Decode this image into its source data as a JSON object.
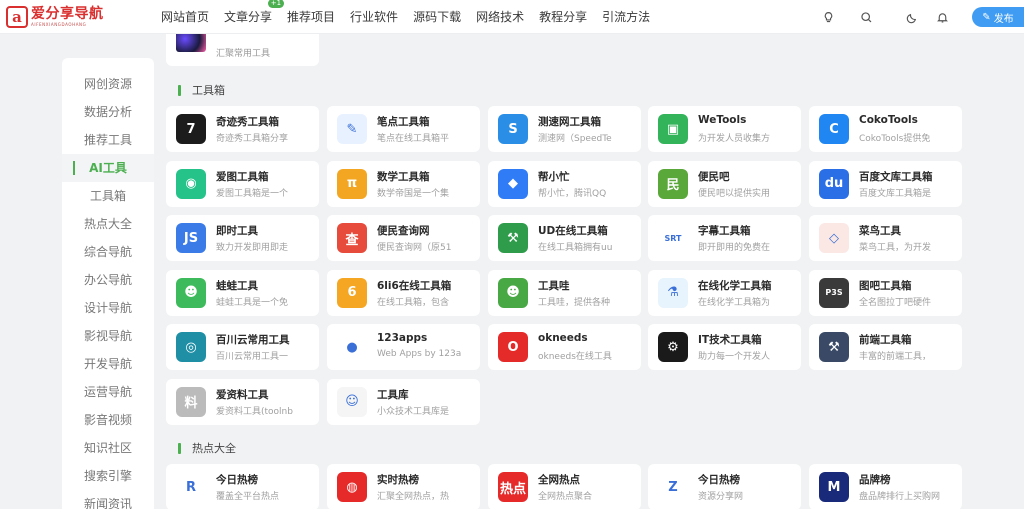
{
  "site": {
    "logo_main": "爱分享导航",
    "logo_sub": "AIFENXIANGDAOHANG",
    "logo_letter": "a"
  },
  "nav": [
    {
      "label": "网站首页"
    },
    {
      "label": "文章分享",
      "badge": "+1"
    },
    {
      "label": "推荐项目"
    },
    {
      "label": "行业软件"
    },
    {
      "label": "源码下载"
    },
    {
      "label": "网络技术"
    },
    {
      "label": "教程分享"
    },
    {
      "label": "引流方法"
    }
  ],
  "header_icons": [
    "lightbulb-icon",
    "search-icon",
    "moon-icon",
    "bell-icon"
  ],
  "publish_label": "发布",
  "sidebar": [
    {
      "label": "网创资源"
    },
    {
      "label": "数据分析"
    },
    {
      "label": "推荐工具"
    },
    {
      "label": "AI工具",
      "active": true
    },
    {
      "label": "工具箱"
    },
    {
      "label": "热点大全"
    },
    {
      "label": "综合导航"
    },
    {
      "label": "办公导航"
    },
    {
      "label": "设计导航"
    },
    {
      "label": "影视导航"
    },
    {
      "label": "开发导航"
    },
    {
      "label": "运营导航"
    },
    {
      "label": "影音视频"
    },
    {
      "label": "知识社区"
    },
    {
      "label": "搜索引擎"
    },
    {
      "label": "新闻资讯"
    }
  ],
  "top_card": {
    "desc": "汇聚常用工具"
  },
  "sections": [
    {
      "title": "工具箱",
      "cards": [
        {
          "title": "奇迹秀工具箱",
          "desc": "奇迹秀工具箱分享",
          "icon": "qijixiu-icon",
          "color": "#1c1c1c",
          "glyph": "7"
        },
        {
          "title": "笔点工具箱",
          "desc": "笔点在线工具箱平",
          "icon": "brush-icon",
          "color": "#e8f1ff",
          "glyph": "✎"
        },
        {
          "title": "测速网工具箱",
          "desc": "测速网（SpeedTe",
          "icon": "speedtest-icon",
          "color": "#2a8ee6",
          "glyph": "S"
        },
        {
          "title": "WeTools",
          "desc": "为开发人员收集方",
          "icon": "toolbox-icon",
          "color": "#33b35a",
          "glyph": "▣"
        },
        {
          "title": "CokoTools",
          "desc": "CokoTools提供免",
          "icon": "coko-icon",
          "color": "#1f86f2",
          "glyph": "C"
        },
        {
          "title": "爱图工具箱",
          "desc": "爱图工具箱是一个",
          "icon": "aitu-icon",
          "color": "#25c28a",
          "glyph": "◉"
        },
        {
          "title": "数学工具箱",
          "desc": "数学帝国是一个集",
          "icon": "pi-icon",
          "color": "#f3a622",
          "glyph": "π"
        },
        {
          "title": "帮小忙",
          "desc": "帮小忙，腾讯QQ",
          "icon": "bangxiaomang-icon",
          "color": "#2f7cf6",
          "glyph": "◆"
        },
        {
          "title": "便民吧",
          "desc": "便民吧以提供实用",
          "icon": "bianmin-icon",
          "color": "#5aa73a",
          "glyph": "民"
        },
        {
          "title": "百度文库工具箱",
          "desc": "百度文库工具箱是",
          "icon": "baidu-icon",
          "color": "#2b6fe6",
          "glyph": "du"
        },
        {
          "title": "即时工具",
          "desc": "致力开发即用即走",
          "icon": "js-icon",
          "color": "#3b7be8",
          "glyph": "JS"
        },
        {
          "title": "便民查询网",
          "desc": "便民查询网（原51",
          "icon": "bianmin-query-icon",
          "color": "#e64b3b",
          "glyph": "查"
        },
        {
          "title": "UD在线工具箱",
          "desc": "在线工具箱拥有uu",
          "icon": "wrench-icon",
          "color": "#2f9c4b",
          "glyph": "⚒"
        },
        {
          "title": "字幕工具箱",
          "desc": "即开即用的免费在",
          "icon": "srt-icon",
          "color": "#ffffff",
          "glyph": "SRT"
        },
        {
          "title": "菜鸟工具",
          "desc": "菜鸟工具，为开发",
          "icon": "runoob-icon",
          "color": "#fbe8e4",
          "glyph": "◇"
        },
        {
          "title": "蛙蛙工具",
          "desc": "蛙蛙工具是一个免",
          "icon": "frog-icon",
          "color": "#3dbb5c",
          "glyph": "☻"
        },
        {
          "title": "6li6在线工具箱",
          "desc": "在线工具箱，包含",
          "icon": "6li6-icon",
          "color": "#f5a623",
          "glyph": "6"
        },
        {
          "title": "工具哇",
          "desc": "工具哇，提供各种",
          "icon": "toolwa-icon",
          "color": "#48a843",
          "glyph": "☻"
        },
        {
          "title": "在线化学工具箱",
          "desc": "在线化学工具箱为",
          "icon": "flask-icon",
          "color": "#e7f3fd",
          "glyph": "⚗"
        },
        {
          "title": "图吧工具箱",
          "desc": "全名图拉丁吧硬件",
          "icon": "p3s-icon",
          "color": "#3a3a3a",
          "glyph": "P3S"
        },
        {
          "title": "百川云常用工具",
          "desc": "百川云常用工具一",
          "icon": "baichuan-icon",
          "color": "#1f8fa6",
          "glyph": "◎"
        },
        {
          "title": "123apps",
          "desc": "Web Apps by 123a",
          "icon": "123apps-icon",
          "color": "#ffffff",
          "glyph": "●"
        },
        {
          "title": "okneeds",
          "desc": "okneeds在线工具",
          "icon": "okneeds-icon",
          "color": "#e52a2a",
          "glyph": "O"
        },
        {
          "title": "IT技术工具箱",
          "desc": "助力每一个开发人",
          "icon": "it-tools-icon",
          "color": "#1a1a1a",
          "glyph": "⚙"
        },
        {
          "title": "前端工具箱",
          "desc": "丰富的前端工具，",
          "icon": "frontend-icon",
          "color": "#3a4a66",
          "glyph": "⚒"
        },
        {
          "title": "爱资料工具",
          "desc": "爱资料工具(toolnb",
          "icon": "toolnb-icon",
          "color": "#bbbbbb",
          "glyph": "料"
        },
        {
          "title": "工具库",
          "desc": "小众技术工具库是",
          "icon": "gongjuku-icon",
          "color": "#f5f5f5",
          "glyph": "☺"
        }
      ]
    },
    {
      "title": "热点大全",
      "cards": [
        {
          "title": "今日热榜",
          "desc": "覆盖全平台热点",
          "icon": "rebang-icon",
          "color": "#ffffff",
          "glyph": "R"
        },
        {
          "title": "实时热榜",
          "desc": "汇聚全网热点，热",
          "icon": "realtime-hot-icon",
          "color": "#e62a2a",
          "glyph": "◍"
        },
        {
          "title": "全网热点",
          "desc": "全网热点聚合",
          "icon": "quanwang-icon",
          "color": "#e62a2a",
          "glyph": "热点"
        },
        {
          "title": "今日热榜",
          "desc": "资源分享网",
          "icon": "z-icon",
          "color": "#ffffff",
          "glyph": "Z"
        },
        {
          "title": "品牌榜",
          "desc": "盘品牌排行上买购网",
          "icon": "maigoo-icon",
          "color": "#1a2a7a",
          "glyph": "M"
        }
      ]
    }
  ]
}
